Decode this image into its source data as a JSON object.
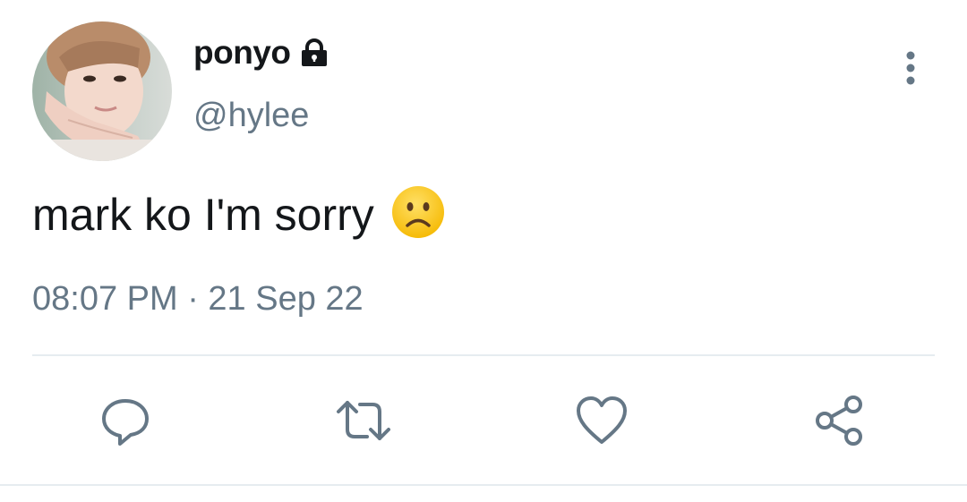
{
  "tweet": {
    "display_name": "ponyo",
    "handle": "@hylee",
    "text": "mark ko I'm sorry",
    "emoji": "frowning-face",
    "timestamp": "08:07 PM · 21 Sep 22",
    "locked": true
  },
  "icons": {
    "lock": "lock-icon",
    "more": "more-vertical-icon",
    "reply": "reply-icon",
    "retweet": "retweet-icon",
    "like": "heart-icon",
    "share": "share-icon"
  },
  "colors": {
    "text_primary": "#14171a",
    "text_secondary": "#657786",
    "icon": "#657786",
    "divider": "#e6ecf0",
    "emoji_fill": "#ffcc33"
  }
}
